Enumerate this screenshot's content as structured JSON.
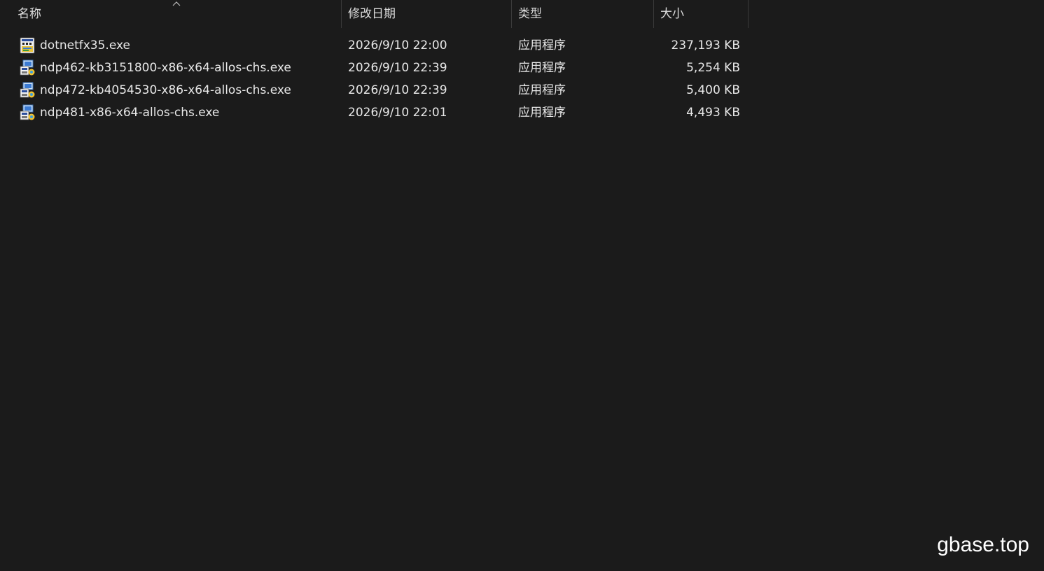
{
  "columns": {
    "name": "名称",
    "date": "修改日期",
    "type": "类型",
    "size": "大小"
  },
  "files": [
    {
      "name": "dotnetfx35.exe",
      "date": "2026/9/10 22:00",
      "type": "应用程序",
      "size": "237,193 KB",
      "icon": "setup-exe-icon"
    },
    {
      "name": "ndp462-kb3151800-x86-x64-allos-chs.exe",
      "date": "2026/9/10 22:39",
      "type": "应用程序",
      "size": "5,254 KB",
      "icon": "installer-exe-icon"
    },
    {
      "name": "ndp472-kb4054530-x86-x64-allos-chs.exe",
      "date": "2026/9/10 22:39",
      "type": "应用程序",
      "size": "5,400 KB",
      "icon": "installer-exe-icon"
    },
    {
      "name": "ndp481-x86-x64-allos-chs.exe",
      "date": "2026/9/10 22:01",
      "type": "应用程序",
      "size": "4,493 KB",
      "icon": "installer-exe-icon"
    }
  ],
  "watermark": "gbase.top",
  "colors": {
    "background": "#1b1b1b",
    "text": "#e8e8e8",
    "separator": "#3a3a3a"
  }
}
